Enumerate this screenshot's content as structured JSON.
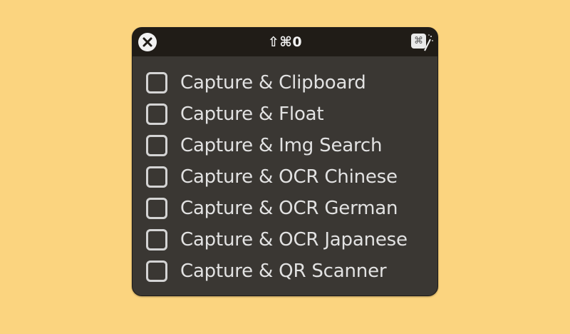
{
  "window": {
    "shortcut": "⇧⌘0",
    "close_icon": "close-icon",
    "command_button_label": "⌘"
  },
  "actions": [
    {
      "label": "Capture & Clipboard",
      "checked": false
    },
    {
      "label": "Capture & Float",
      "checked": false
    },
    {
      "label": "Capture & Img Search",
      "checked": false
    },
    {
      "label": "Capture & OCR Chinese",
      "checked": false
    },
    {
      "label": "Capture & OCR German",
      "checked": false
    },
    {
      "label": "Capture & OCR Japanese",
      "checked": false
    },
    {
      "label": "Capture & QR Scanner",
      "checked": false
    }
  ],
  "colors": {
    "desktop_background": "#fbd47f",
    "panel_background": "#3a3733",
    "titlebar_background": "#201c17",
    "text": "#e2e2e2"
  }
}
